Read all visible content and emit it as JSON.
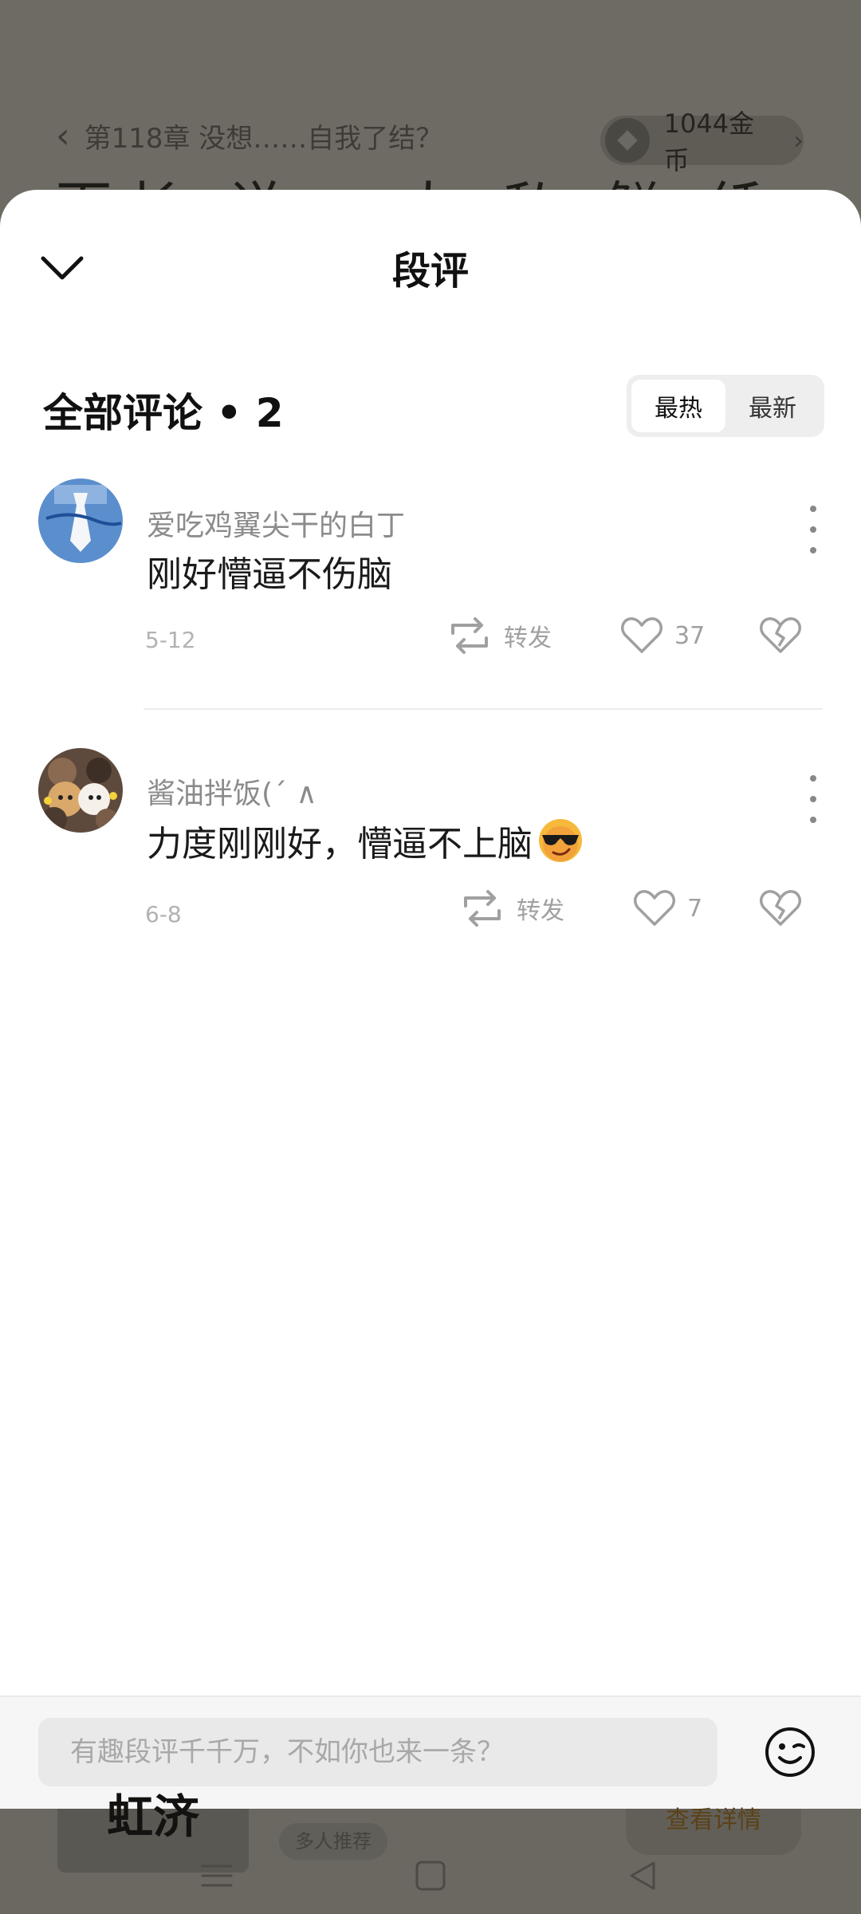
{
  "background": {
    "chapter_title": "第118章 没想……自我了结？",
    "coins": "1044金币",
    "big_text": "而长 说 ，人 私 鲜 纤 什 贴 终 之 上",
    "tag_text": "虹济",
    "recommend": "多人推荐",
    "detail_button": "查看详情"
  },
  "sheet": {
    "title": "段评",
    "section_title": "全部评论 • 2",
    "sort_hot": "最热",
    "sort_new": "最新"
  },
  "comments": [
    {
      "name": "爱吃鸡翼尖干的白丁",
      "text": "刚好懵逼不伤脑",
      "date": "5-12",
      "repost_label": "转发",
      "likes": "37"
    },
    {
      "name": "酱油拌饭(ˊ ∧",
      "text": "力度刚刚好，懵逼不上脑",
      "date": "6-8",
      "repost_label": "转发",
      "likes": "7"
    }
  ],
  "input": {
    "placeholder": "有趣段评千千万，不如你也来一条？"
  },
  "colors": {
    "sheet_bg": "#ffffff",
    "dim_bg": "#6b6862",
    "muted_text": "#a0a0a0"
  }
}
